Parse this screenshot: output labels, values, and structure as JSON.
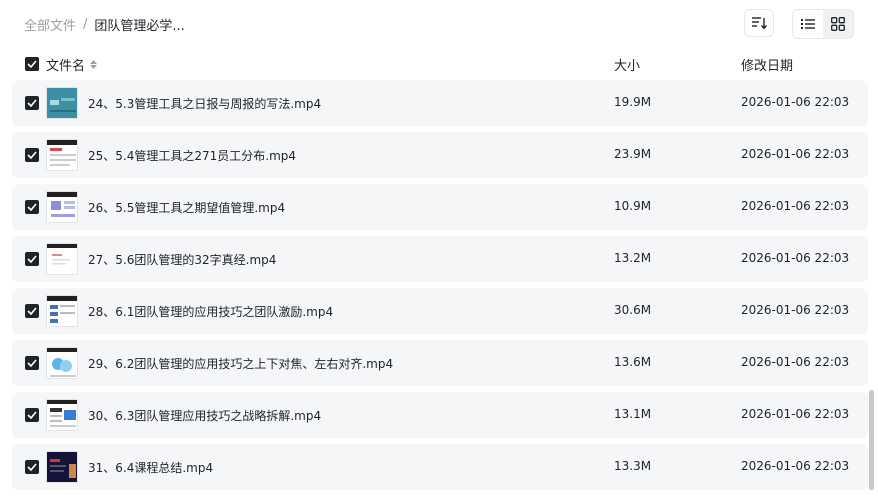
{
  "breadcrumb": {
    "root": "全部文件",
    "separator": "/",
    "current": "团队管理必学..."
  },
  "columns": {
    "name": "文件名",
    "size": "大小",
    "modified": "修改日期"
  },
  "files": [
    {
      "name": "24、5.3管理工具之日报与周报的写法.mp4",
      "size": "19.9M",
      "modified": "2026-01-06 22:03"
    },
    {
      "name": "25、5.4管理工具之271员工分布.mp4",
      "size": "23.9M",
      "modified": "2026-01-06 22:03"
    },
    {
      "name": "26、5.5管理工具之期望值管理.mp4",
      "size": "10.9M",
      "modified": "2026-01-06 22:03"
    },
    {
      "name": "27、5.6团队管理的32字真经.mp4",
      "size": "13.2M",
      "modified": "2026-01-06 22:03"
    },
    {
      "name": "28、6.1团队管理的应用技巧之团队激励.mp4",
      "size": "30.6M",
      "modified": "2026-01-06 22:03"
    },
    {
      "name": "29、6.2团队管理的应用技巧之上下对焦、左右对齐.mp4",
      "size": "13.6M",
      "modified": "2026-01-06 22:03"
    },
    {
      "name": "30、6.3团队管理应用技巧之战略拆解.mp4",
      "size": "13.1M",
      "modified": "2026-01-06 22:03"
    },
    {
      "name": "31、6.4课程总结.mp4",
      "size": "13.3M",
      "modified": "2026-01-06 22:03"
    }
  ],
  "colors": {
    "text": "#1f2329",
    "muted": "#9aa0a6",
    "row_bg": "#f5f6f8",
    "checkbox": "#1f2329"
  },
  "icons": {
    "sort": "sort-lines-icon",
    "list_view": "list-view-icon",
    "grid_view": "grid-view-icon",
    "check": "check-icon"
  }
}
